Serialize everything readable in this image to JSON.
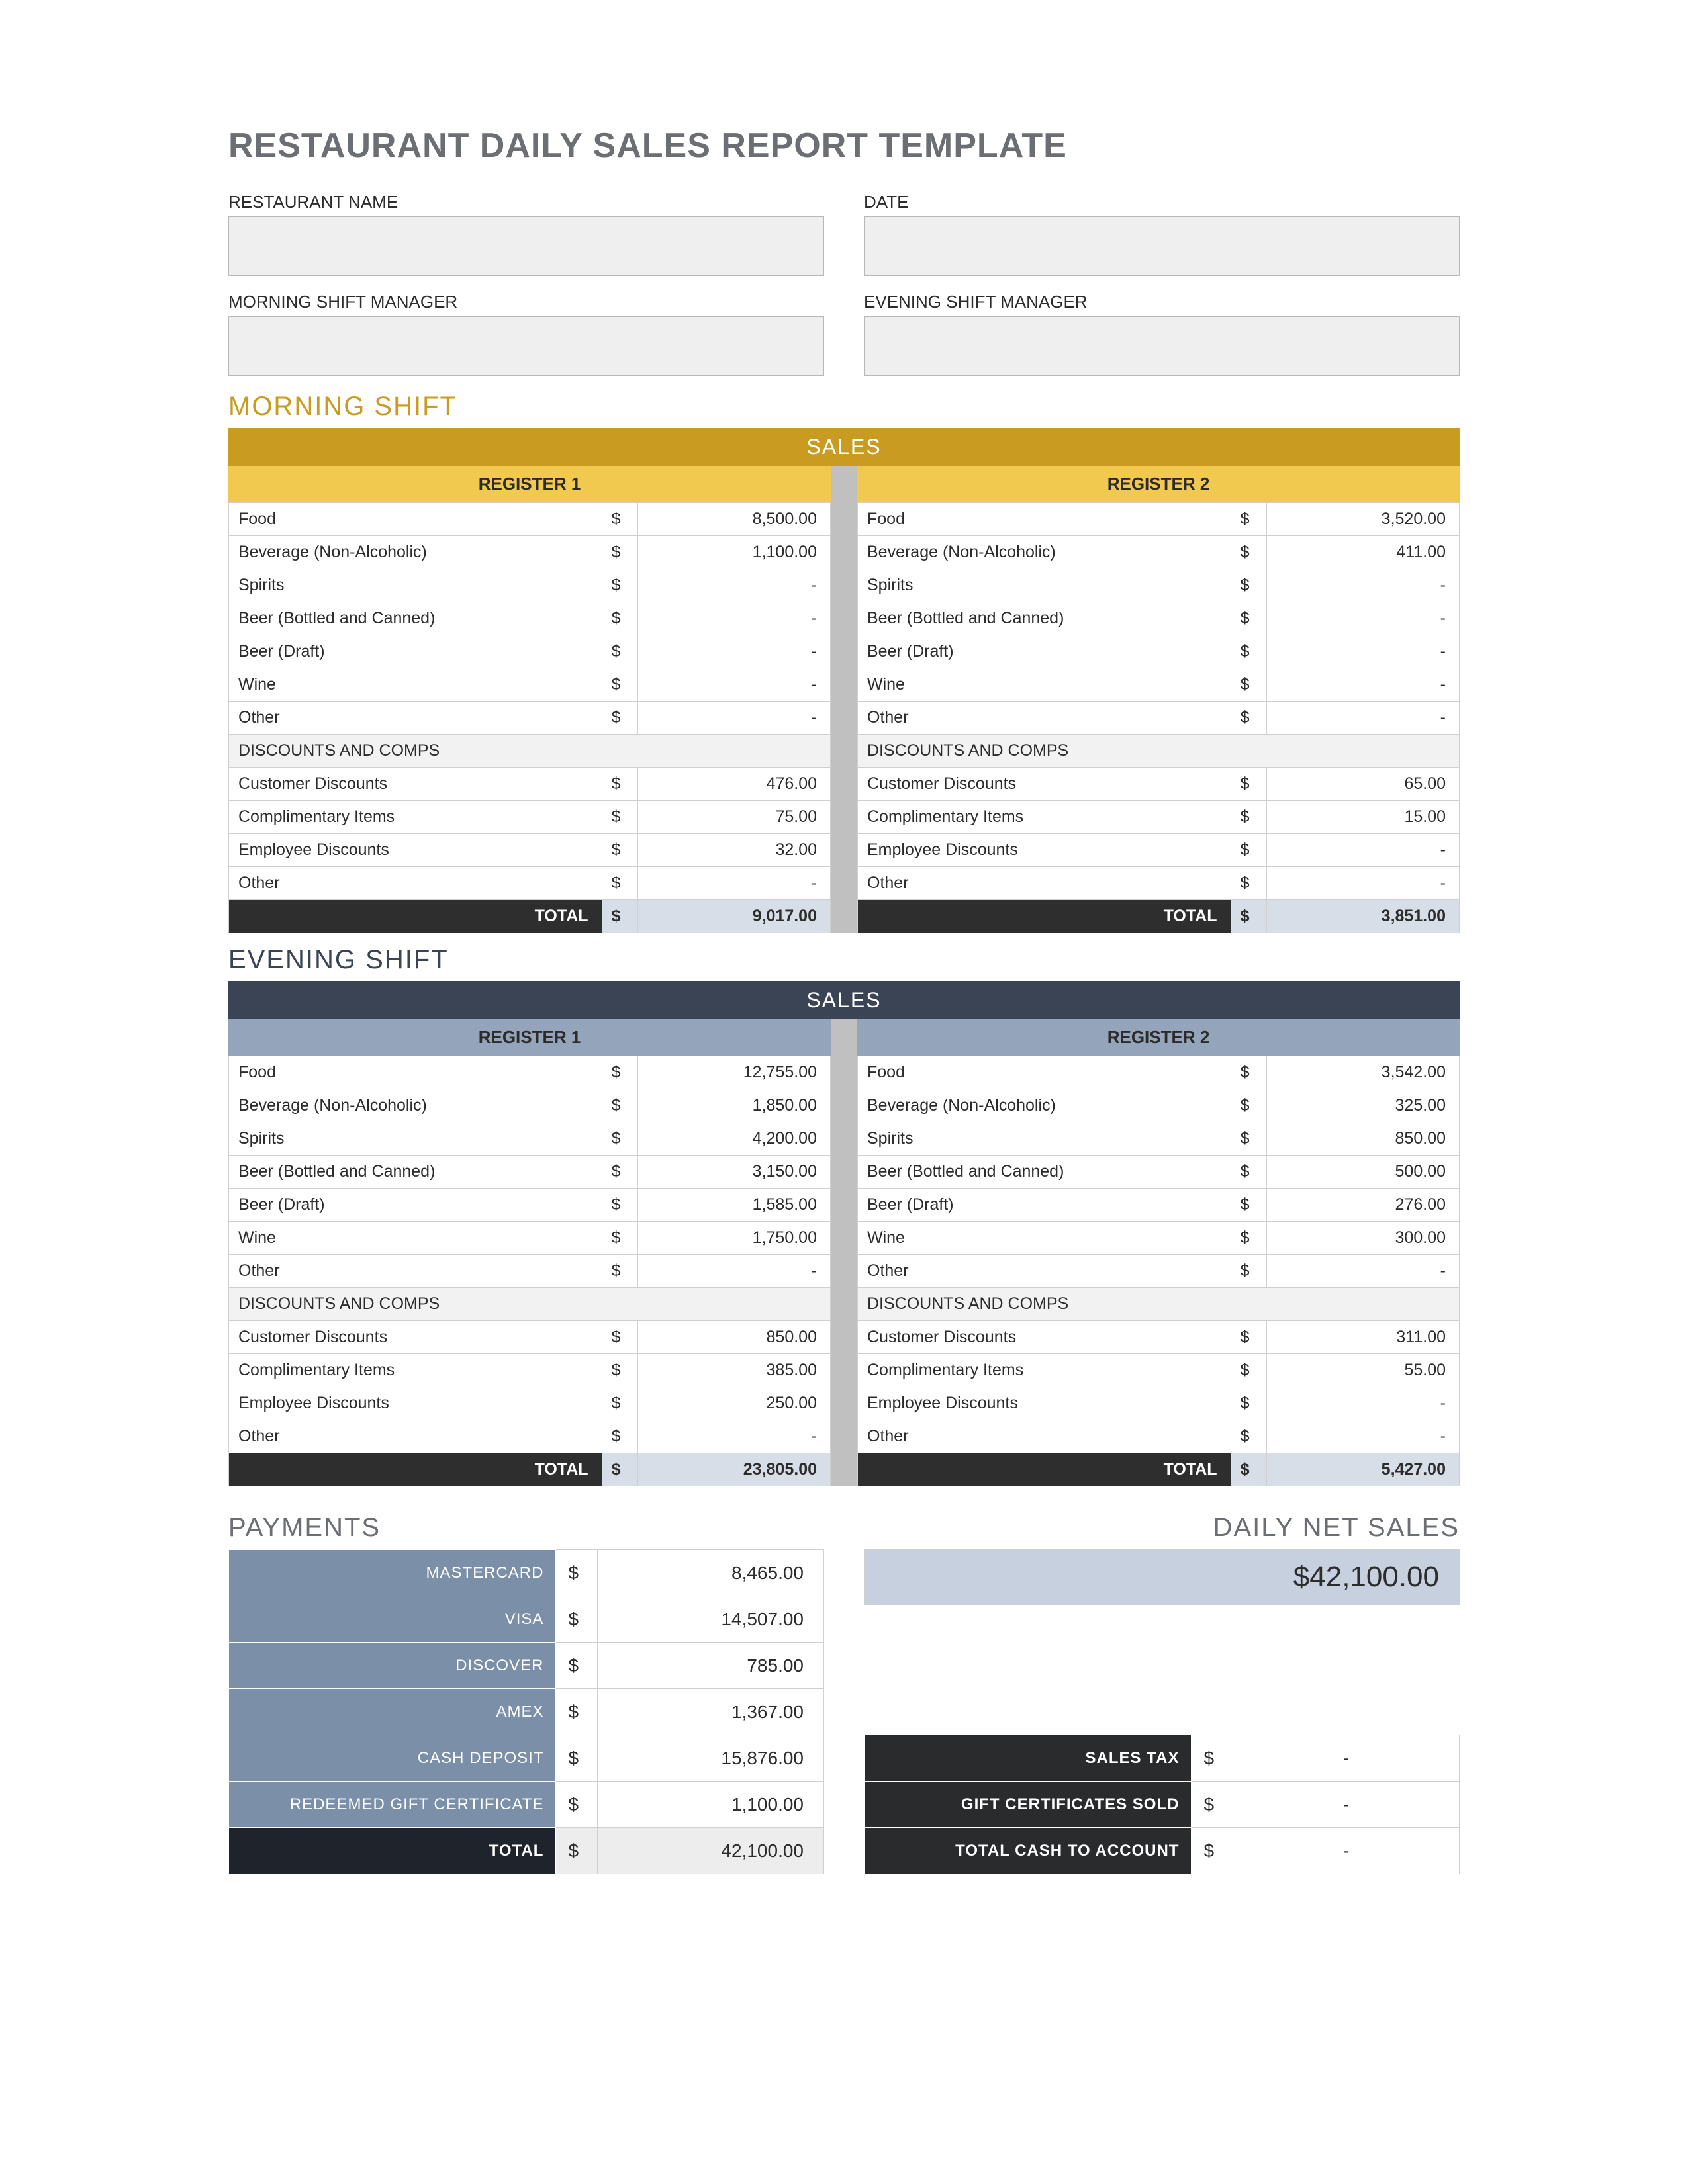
{
  "title": "RESTAURANT DAILY SALES REPORT TEMPLATE",
  "fields": {
    "restaurant_name_label": "RESTAURANT NAME",
    "date_label": "DATE",
    "morning_mgr_label": "MORNING SHIFT MANAGER",
    "evening_mgr_label": "EVENING SHIFT MANAGER"
  },
  "labels": {
    "sales_banner": "SALES",
    "register1": "REGISTER 1",
    "register2": "REGISTER 2",
    "discounts_section": "DISCOUNTS AND COMPS",
    "total": "TOTAL",
    "dollar": "$",
    "dash": "-",
    "payments_title": "PAYMENTS",
    "netsales_title": "DAILY NET SALES"
  },
  "shifts": {
    "morning": {
      "title": "MORNING SHIFT",
      "reg1": {
        "sales": [
          {
            "label": "Food",
            "value": "8,500.00"
          },
          {
            "label": "Beverage (Non-Alcoholic)",
            "value": "1,100.00"
          },
          {
            "label": "Spirits",
            "value": "-"
          },
          {
            "label": "Beer (Bottled and Canned)",
            "value": "-"
          },
          {
            "label": "Beer (Draft)",
            "value": "-"
          },
          {
            "label": "Wine",
            "value": "-"
          },
          {
            "label": "Other",
            "value": "-"
          }
        ],
        "discounts": [
          {
            "label": "Customer Discounts",
            "value": "476.00"
          },
          {
            "label": "Complimentary Items",
            "value": "75.00"
          },
          {
            "label": "Employee Discounts",
            "value": "32.00"
          },
          {
            "label": "Other",
            "value": "-"
          }
        ],
        "total": "9,017.00"
      },
      "reg2": {
        "sales": [
          {
            "label": "Food",
            "value": "3,520.00"
          },
          {
            "label": "Beverage (Non-Alcoholic)",
            "value": "411.00"
          },
          {
            "label": "Spirits",
            "value": "-"
          },
          {
            "label": "Beer (Bottled and Canned)",
            "value": "-"
          },
          {
            "label": "Beer (Draft)",
            "value": "-"
          },
          {
            "label": "Wine",
            "value": "-"
          },
          {
            "label": "Other",
            "value": "-"
          }
        ],
        "discounts": [
          {
            "label": "Customer Discounts",
            "value": "65.00"
          },
          {
            "label": "Complimentary Items",
            "value": "15.00"
          },
          {
            "label": "Employee Discounts",
            "value": "-"
          },
          {
            "label": "Other",
            "value": "-"
          }
        ],
        "total": "3,851.00"
      }
    },
    "evening": {
      "title": "EVENING SHIFT",
      "reg1": {
        "sales": [
          {
            "label": "Food",
            "value": "12,755.00"
          },
          {
            "label": "Beverage (Non-Alcoholic)",
            "value": "1,850.00"
          },
          {
            "label": "Spirits",
            "value": "4,200.00"
          },
          {
            "label": "Beer (Bottled and Canned)",
            "value": "3,150.00"
          },
          {
            "label": "Beer (Draft)",
            "value": "1,585.00"
          },
          {
            "label": "Wine",
            "value": "1,750.00"
          },
          {
            "label": "Other",
            "value": "-"
          }
        ],
        "discounts": [
          {
            "label": "Customer Discounts",
            "value": "850.00"
          },
          {
            "label": "Complimentary Items",
            "value": "385.00"
          },
          {
            "label": "Employee Discounts",
            "value": "250.00"
          },
          {
            "label": "Other",
            "value": "-"
          }
        ],
        "total": "23,805.00"
      },
      "reg2": {
        "sales": [
          {
            "label": "Food",
            "value": "3,542.00"
          },
          {
            "label": "Beverage (Non-Alcoholic)",
            "value": "325.00"
          },
          {
            "label": "Spirits",
            "value": "850.00"
          },
          {
            "label": "Beer (Bottled and Canned)",
            "value": "500.00"
          },
          {
            "label": "Beer (Draft)",
            "value": "276.00"
          },
          {
            "label": "Wine",
            "value": "300.00"
          },
          {
            "label": "Other",
            "value": "-"
          }
        ],
        "discounts": [
          {
            "label": "Customer Discounts",
            "value": "311.00"
          },
          {
            "label": "Complimentary Items",
            "value": "55.00"
          },
          {
            "label": "Employee Discounts",
            "value": "-"
          },
          {
            "label": "Other",
            "value": "-"
          }
        ],
        "total": "5,427.00"
      }
    }
  },
  "payments": {
    "rows": [
      {
        "label": "MASTERCARD",
        "value": "8,465.00"
      },
      {
        "label": "VISA",
        "value": "14,507.00"
      },
      {
        "label": "DISCOVER",
        "value": "785.00"
      },
      {
        "label": "AMEX",
        "value": "1,367.00"
      },
      {
        "label": "CASH DEPOSIT",
        "value": "15,876.00"
      },
      {
        "label": "REDEEMED GIFT CERTIFICATE",
        "value": "1,100.00"
      }
    ],
    "total": "42,100.00"
  },
  "net_sales": {
    "value": "$42,100.00",
    "rows": [
      {
        "label": "SALES TAX",
        "value": "-"
      },
      {
        "label": "GIFT CERTIFICATES SOLD",
        "value": "-"
      },
      {
        "label": "TOTAL CASH TO ACCOUNT",
        "value": "-"
      }
    ]
  }
}
